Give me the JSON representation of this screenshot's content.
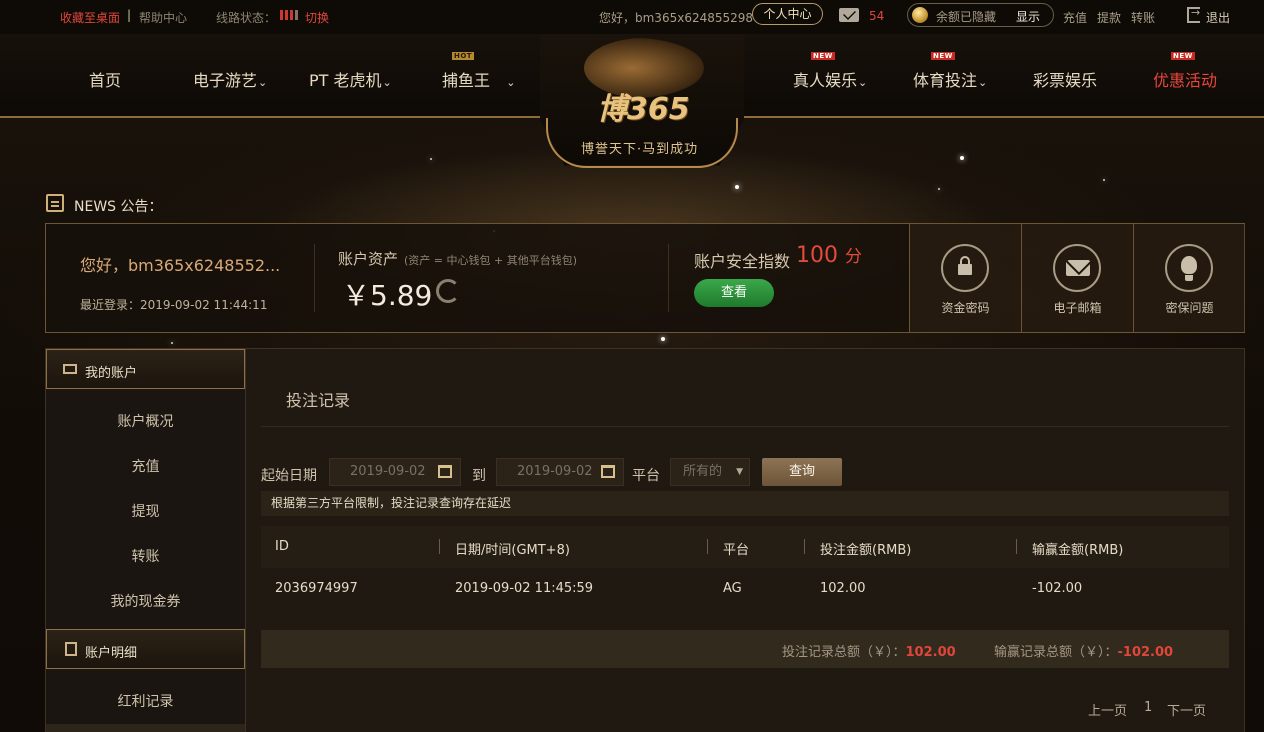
{
  "topbar": {
    "favorite": "收藏至桌面",
    "separator": "|",
    "help": "帮助中心",
    "line_status": "线路状态：",
    "switch": "切换",
    "greeting": "您好，bm365x624855298",
    "personal_center": "个人中心",
    "mail_count": "54",
    "balance_hidden": "余额已隐藏",
    "show": "显示",
    "recharge": "充值",
    "withdraw": "提款",
    "transfer": "转账",
    "logout": "退出"
  },
  "nav": {
    "home": "首页",
    "egames": "电子游艺",
    "pt_slots": "PT 老虎机",
    "fishing": "捕鱼王",
    "live": "真人娱乐",
    "sports": "体育投注",
    "lottery": "彩票娱乐",
    "promos": "优惠活动",
    "hot_badge": "HOT",
    "new_badge": "NEW",
    "chevron": "⌄"
  },
  "logo": {
    "brand": "博365",
    "slogan": "博誉天下·马到成功"
  },
  "news": {
    "label": "NEWS 公告："
  },
  "account": {
    "greeting": "您好，bm365x6248552...",
    "last_login": "最近登录：2019-09-02 11:44:11",
    "assets_label": "账户资产",
    "assets_note": "(资产 = 中心钱包 + 其他平台钱包)",
    "amount": "￥5.89",
    "security_label": "账户安全指数",
    "security_score": "100",
    "security_unit": "分",
    "view_button": "查看",
    "boxes": [
      {
        "label": "资金密码",
        "icon": "lock-icon"
      },
      {
        "label": "电子邮箱",
        "icon": "envelope-icon"
      },
      {
        "label": "密保问题",
        "icon": "bulb-icon"
      }
    ]
  },
  "sidebar": {
    "my_account": "我的账户",
    "items": [
      "账户概况",
      "充值",
      "提现",
      "转账",
      "我的现金券"
    ],
    "account_detail": "账户明细",
    "detail_items": [
      "红利记录"
    ]
  },
  "content": {
    "title": "投注记录",
    "filter": {
      "start_label": "起始日期",
      "start_date": "2019-09-02",
      "to_label": "到",
      "end_date": "2019-09-02",
      "platform_label": "平台",
      "platform_value": "所有的",
      "query_button": "查询"
    },
    "notice": "根据第三方平台限制，投注记录查询存在延迟",
    "table": {
      "headers": [
        "ID",
        "日期/时间(GMT+8)",
        "平台",
        "投注金额(RMB)",
        "输赢金额(RMB)"
      ],
      "rows": [
        [
          "2036974997",
          "2019-09-02 11:45:59",
          "AG",
          "102.00",
          "-102.00"
        ]
      ]
    },
    "totals": {
      "bet_label": "投注记录总额（￥）：",
      "bet_value": "102.00",
      "win_label": "输赢记录总额（￥）：",
      "win_value": "-102.00"
    },
    "pager": {
      "prev": "上一页",
      "page": "1",
      "next": "下一页"
    }
  },
  "colors": {
    "accent_red": "#e0463a",
    "gold": "#b58a4a",
    "green_button": "#2a9038"
  }
}
